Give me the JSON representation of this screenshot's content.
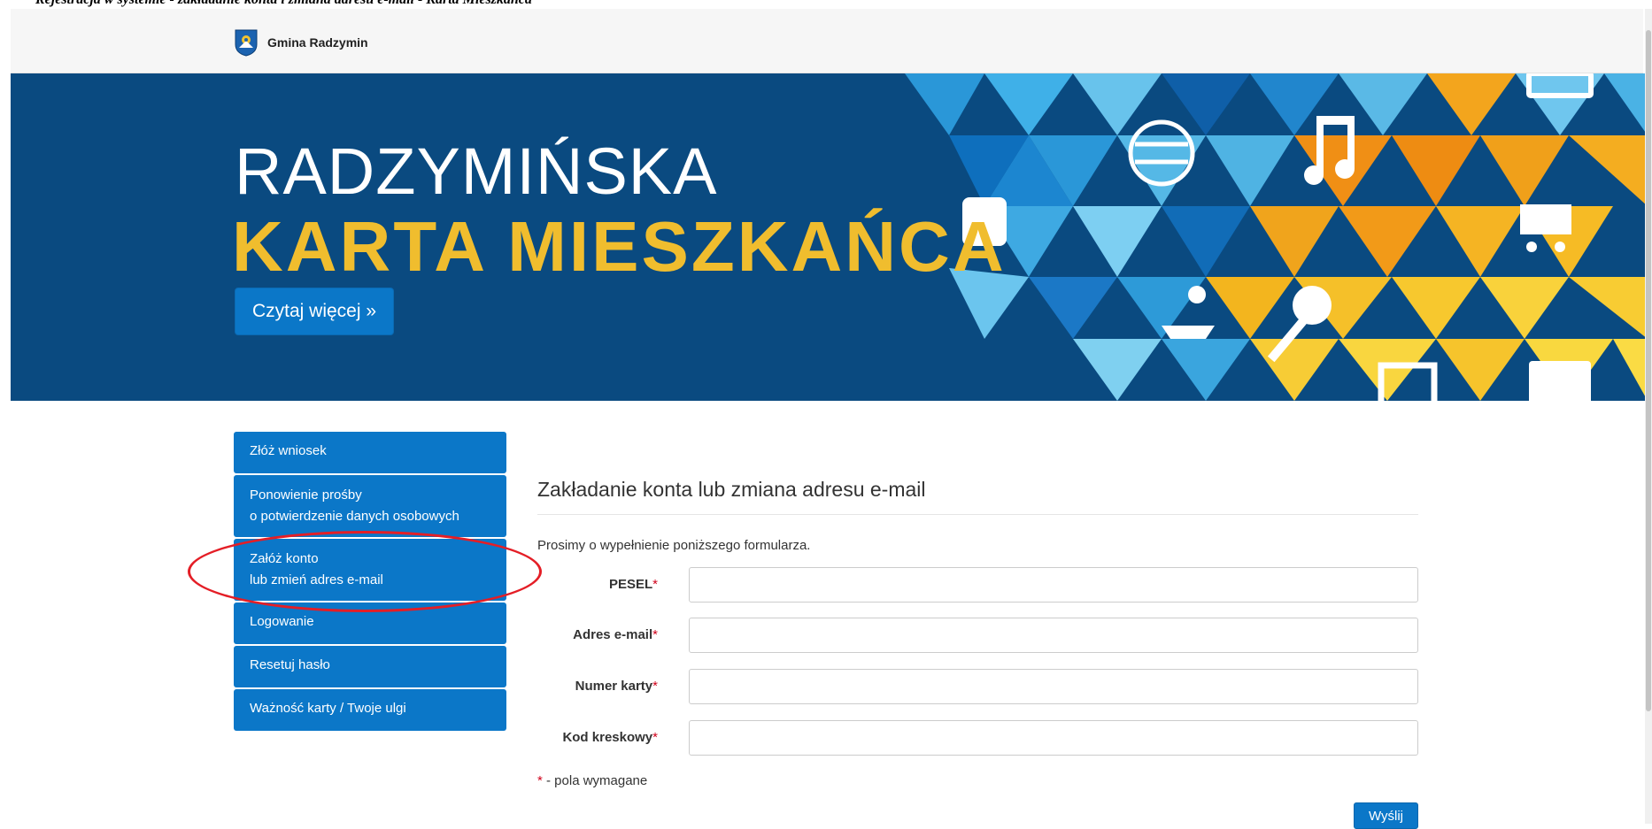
{
  "top_strip_text": "Rejestracja w systemie - zakładanie konta i zmiana adresu e-mail - Karta Mieszkańca",
  "brand": {
    "name": "Gmina Radzymin"
  },
  "hero": {
    "line1": "RADZYMIŃSKA",
    "line2": "KARTA MIESZKAŃCA",
    "button_label": "Czytaj więcej »"
  },
  "sidebar": {
    "items": [
      {
        "label": "Złóż wniosek"
      },
      {
        "line1": "Ponowienie prośby",
        "line2": "o potwierdzenie danych osobowych"
      },
      {
        "line1": "Załóż konto",
        "line2": "lub zmień adres e-mail"
      },
      {
        "label": "Logowanie"
      },
      {
        "label": "Resetuj hasło"
      },
      {
        "label": "Ważność karty / Twoje ulgi"
      }
    ]
  },
  "form": {
    "title": "Zakładanie konta lub zmiana adresu e-mail",
    "intro": "Prosimy o wypełnienie poniższego formularza.",
    "fields": [
      {
        "label": "PESEL",
        "value": ""
      },
      {
        "label": "Adres e-mail",
        "value": ""
      },
      {
        "label": "Numer karty",
        "value": ""
      },
      {
        "label": "Kod kreskowy",
        "value": ""
      }
    ],
    "required_marker": "*",
    "required_note": " - pola wymagane",
    "submit_label": "Wyślij"
  },
  "colors": {
    "primary": "#0b77c8",
    "hero_bg": "#0a4a80",
    "hero_accent": "#f0bd2e",
    "annotation": "#e41e26"
  }
}
